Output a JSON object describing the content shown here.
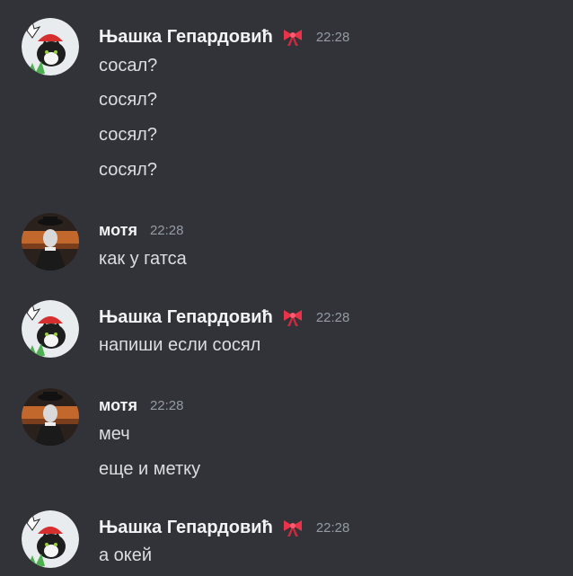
{
  "users": {
    "njashka": {
      "name": "Њашка Гепардовић",
      "badge_icon": "ribbon-bow-icon",
      "badge_color": "#e8334a"
    },
    "motya": {
      "name": "мотя"
    }
  },
  "groups": [
    {
      "time": "22:28",
      "lines": [
        "сосал?",
        "сосял?",
        "сосял?",
        "сосял?"
      ]
    },
    {
      "time": "22:28",
      "lines": [
        "как у гатса"
      ]
    },
    {
      "time": "22:28",
      "lines": [
        "напиши если сосял"
      ]
    },
    {
      "time": "22:28",
      "lines": [
        "меч",
        "еще и метку"
      ]
    },
    {
      "time": "22:28",
      "lines": [
        "а окей"
      ]
    }
  ],
  "colors": {
    "background": "#313338",
    "username": "#f2f3f5",
    "timestamp": "#949ba4",
    "text": "#dbdee1"
  }
}
